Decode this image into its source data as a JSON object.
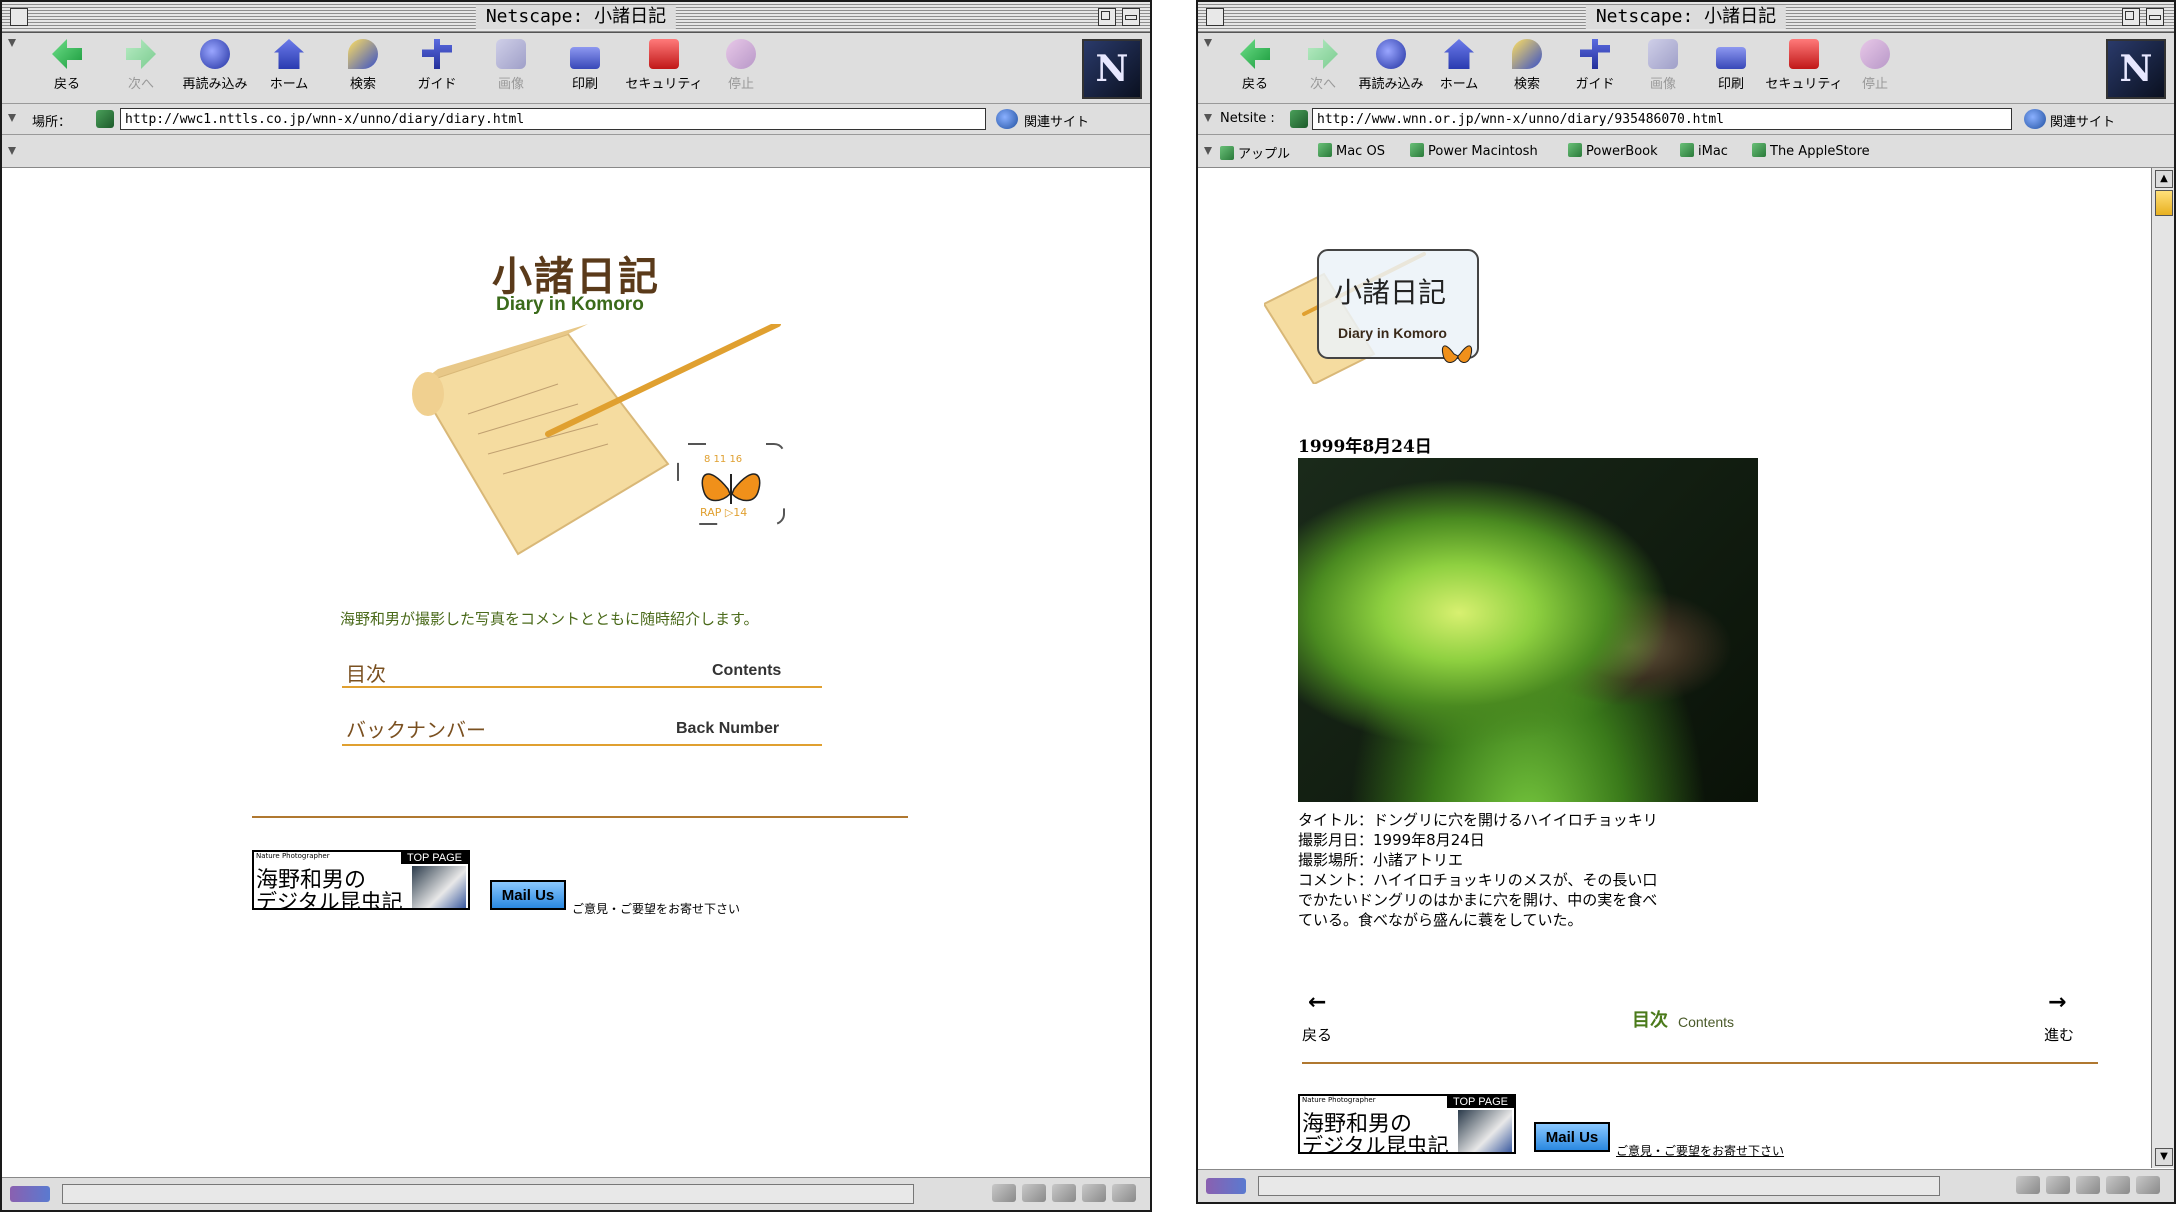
{
  "left": {
    "title": "Netscape: 小諸日記",
    "toolbar": [
      {
        "label": "戻る",
        "icon": "back-arrow-icon"
      },
      {
        "label": "次へ",
        "icon": "forward-arrow-icon"
      },
      {
        "label": "再読み込み",
        "icon": "reload-icon"
      },
      {
        "label": "ホーム",
        "icon": "home-icon"
      },
      {
        "label": "検索",
        "icon": "search-icon"
      },
      {
        "label": "ガイド",
        "icon": "guide-icon"
      },
      {
        "label": "画像",
        "icon": "images-icon"
      },
      {
        "label": "印刷",
        "icon": "print-icon"
      },
      {
        "label": "セキュリティ",
        "icon": "security-lock-icon"
      },
      {
        "label": "停止",
        "icon": "stop-icon"
      }
    ],
    "location_label": "場所：",
    "url": "http://wwc1.nttls.co.jp/wnn-x/unno/diary/diary.html",
    "related": "関連サイト",
    "page": {
      "logo_jp": "小諸日記",
      "logo_en": "Diary in Komoro",
      "butterfly_nums": "8  11  16",
      "butterfly_tag": "RAP ▷14",
      "intro": "海野和男が撮影した写真をコメントとともに随時紹介します。",
      "nav": [
        {
          "jp": "目次",
          "en": "Contents"
        },
        {
          "jp": "バックナンバー",
          "en": "Back Number"
        }
      ],
      "banner": {
        "np": "Nature Photographer",
        "top": "TOP PAGE",
        "line1": "海野和男の",
        "line2": "デジタル昆虫記"
      },
      "mail": "Mail Us",
      "mail_note": "ご意見・ご要望をお寄せ下さい"
    }
  },
  "right": {
    "title": "Netscape: 小諸日記",
    "toolbar": [
      {
        "label": "戻る"
      },
      {
        "label": "次へ"
      },
      {
        "label": "再読み込み"
      },
      {
        "label": "ホーム"
      },
      {
        "label": "検索"
      },
      {
        "label": "ガイド"
      },
      {
        "label": "画像"
      },
      {
        "label": "印刷"
      },
      {
        "label": "セキュリティ"
      },
      {
        "label": "停止"
      }
    ],
    "location_label": "Netsite :",
    "url": "http://www.wnn.or.jp/wnn-x/unno/diary/935486070.html",
    "related": "関連サイト",
    "personal": [
      "アップル",
      "Mac OS",
      "Power Macintosh",
      "PowerBook",
      "iMac",
      "The AppleStore"
    ],
    "page": {
      "logo_jp": "小諸日記",
      "logo_en": "Diary in Komoro",
      "date": "1999年8月24日",
      "info": [
        "タイトル：ドングリに穴を開けるハイイロチョッキリ",
        "撮影月日：1999年8月24日",
        "撮影場所：小諸アトリエ",
        "コメント：ハイイロチョッキリのメスが、その長い口",
        "でかたいドングリのはかまに穴を開け、中の実を食べ",
        "ている。食べながら盛んに蓑をしていた。"
      ],
      "back_arrow": "←",
      "back": "戻る",
      "toc_jp": "目次",
      "toc_en": "Contents",
      "fwd_arrow": "→",
      "fwd": "進む",
      "banner": {
        "np": "Nature Photographer",
        "top": "TOP PAGE",
        "line1": "海野和男の",
        "line2": "デジタル昆虫記"
      },
      "mail": "Mail Us",
      "mail_note": "ご意見・ご要望をお寄せ下さい"
    }
  },
  "colors": {
    "accent_orange": "#e0a030",
    "brown": "#b07830",
    "green_text": "#4a6a1a"
  }
}
